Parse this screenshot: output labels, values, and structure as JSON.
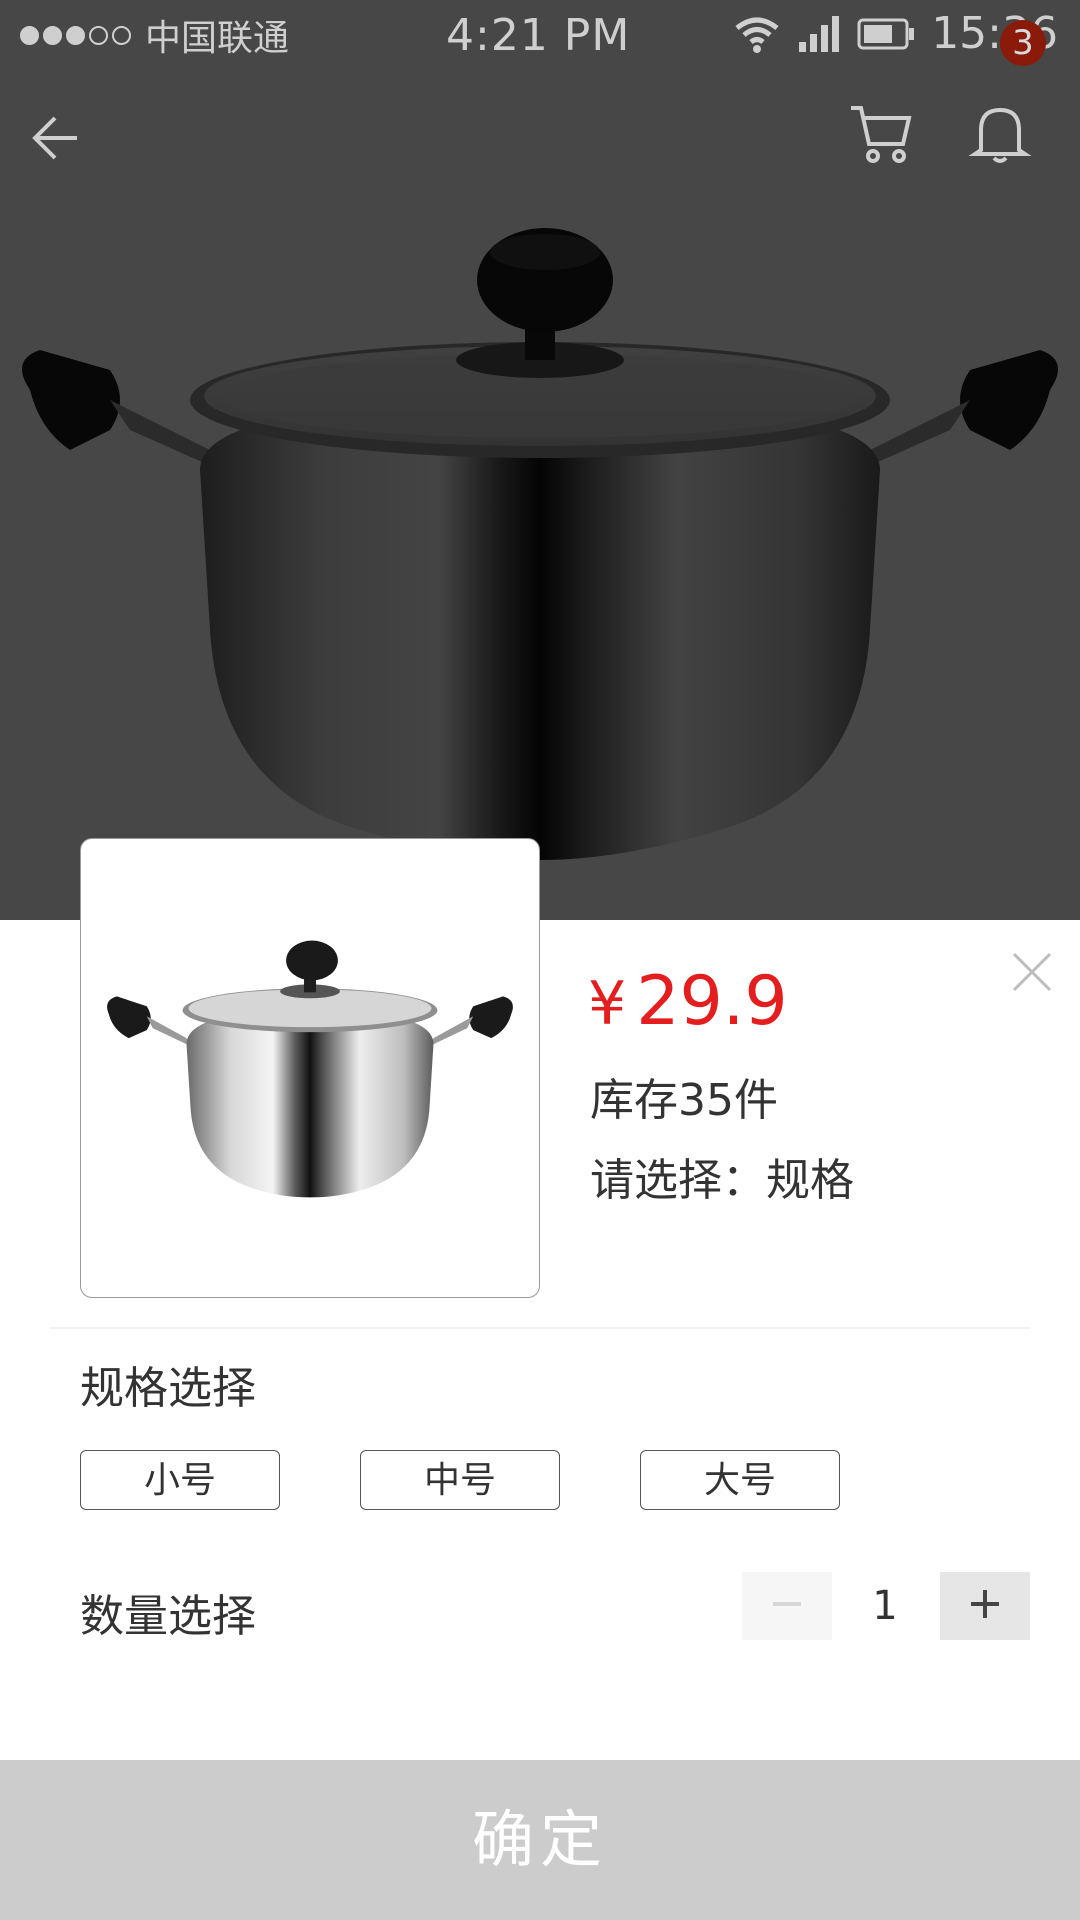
{
  "status_bar": {
    "carrier": "中国联通",
    "clock": "4:21 PM",
    "time": "15:36",
    "signal_dots_filled": 3,
    "signal_dots_total": 5
  },
  "nav": {
    "back_icon": "arrow-left-icon",
    "cart_icon": "cart-icon",
    "bell_icon": "bell-icon",
    "notification_count": "3"
  },
  "product": {
    "image": "stainless-steel-pot",
    "currency": "¥",
    "price": "29.9",
    "stock": "库存35件",
    "select_hint": "请选择：规格"
  },
  "spec": {
    "title": "规格选择",
    "options": [
      "小号",
      "中号",
      "大号"
    ]
  },
  "quantity": {
    "title": "数量选择",
    "value": "1",
    "minus_icon": "minus-icon",
    "plus_icon": "plus-icon"
  },
  "confirm_label": "确定",
  "colors": {
    "price": "#e41e1e",
    "badge": "#8a1a0a",
    "confirm_bg": "#cccccc"
  }
}
